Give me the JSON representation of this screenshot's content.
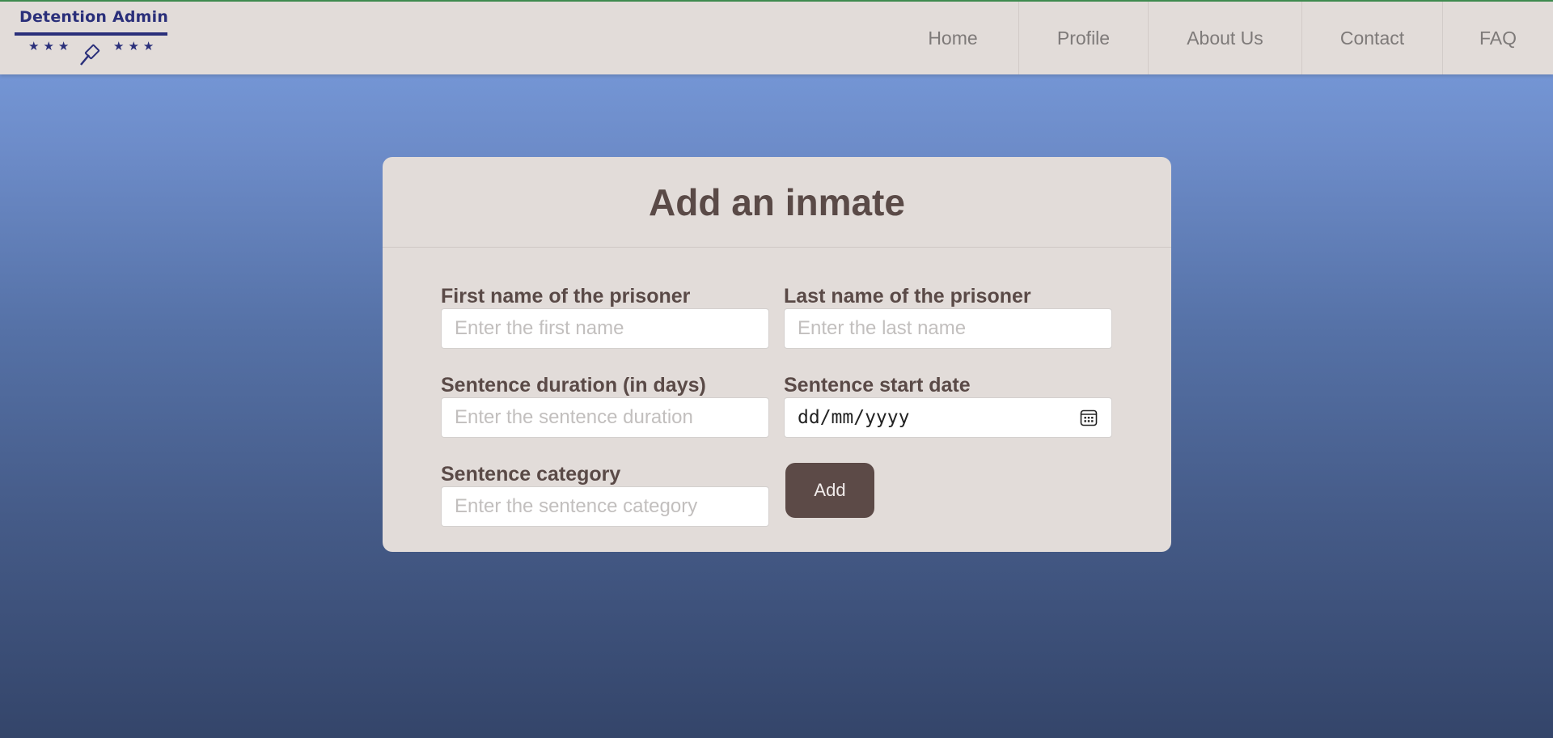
{
  "brand": {
    "title": "Detention Admin",
    "stars_left": "★★★",
    "stars_right": "★★★"
  },
  "nav": {
    "items": [
      {
        "label": "Home"
      },
      {
        "label": "Profile"
      },
      {
        "label": "About Us"
      },
      {
        "label": "Contact"
      },
      {
        "label": "FAQ"
      }
    ]
  },
  "form": {
    "title": "Add an inmate",
    "first_name": {
      "label": "First name of the prisoner",
      "placeholder": "Enter the first name",
      "value": ""
    },
    "last_name": {
      "label": "Last name of the prisoner",
      "placeholder": "Enter the last name",
      "value": ""
    },
    "duration": {
      "label": "Sentence duration (in days)",
      "placeholder": "Enter the sentence duration",
      "value": ""
    },
    "start_date": {
      "label": "Sentence start date",
      "value": "dd/mm/yyyy"
    },
    "category": {
      "label": "Sentence category",
      "placeholder": "Enter the sentence category",
      "value": ""
    },
    "submit_label": "Add"
  },
  "colors": {
    "brand": "#2a2f7a",
    "accent_top_border": "#3e8a4f",
    "panel_bg": "#e2dcd9",
    "text_primary": "#5a4a47",
    "button_bg": "#5c4a47"
  }
}
